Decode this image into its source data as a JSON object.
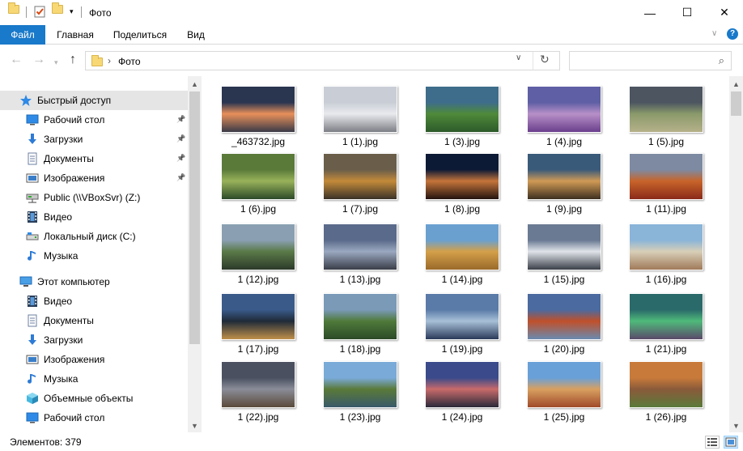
{
  "window": {
    "title": "Фото"
  },
  "titlebar": {
    "minimize": "—",
    "maximize": "☐",
    "close": "✕"
  },
  "ribbon": {
    "tabs": [
      "Файл",
      "Главная",
      "Поделиться",
      "Вид"
    ]
  },
  "address": {
    "crumb_sep": "›",
    "current": "Фото",
    "search_placeholder": ""
  },
  "nav": {
    "items": [
      {
        "label": "Быстрый доступ",
        "icon": "star-icon",
        "pinned": false,
        "selected": true
      },
      {
        "label": "Рабочий стол",
        "icon": "desktop-icon",
        "pinned": true
      },
      {
        "label": "Загрузки",
        "icon": "downloads-icon",
        "pinned": true
      },
      {
        "label": "Документы",
        "icon": "documents-icon",
        "pinned": true
      },
      {
        "label": "Изображения",
        "icon": "pictures-icon",
        "pinned": true
      },
      {
        "label": "Public (\\\\VBoxSvr) (Z:)",
        "icon": "network-drive-icon",
        "pinned": false
      },
      {
        "label": "Видео",
        "icon": "video-icon",
        "pinned": false
      },
      {
        "label": "Локальный диск (C:)",
        "icon": "local-disk-icon",
        "pinned": false
      },
      {
        "label": "Музыка",
        "icon": "music-icon",
        "pinned": false
      },
      {
        "label": "Этот компьютер",
        "icon": "this-pc-icon",
        "pinned": false
      },
      {
        "label": "Видео",
        "icon": "video-icon",
        "pinned": false
      },
      {
        "label": "Документы",
        "icon": "documents-icon",
        "pinned": false
      },
      {
        "label": "Загрузки",
        "icon": "downloads-icon",
        "pinned": false
      },
      {
        "label": "Изображения",
        "icon": "pictures-icon",
        "pinned": false
      },
      {
        "label": "Музыка",
        "icon": "music-icon",
        "pinned": false
      },
      {
        "label": "Объемные объекты",
        "icon": "3d-objects-icon",
        "pinned": false
      },
      {
        "label": "Рабочий стол",
        "icon": "desktop-icon",
        "pinned": false
      }
    ]
  },
  "files": [
    {
      "name": "_463732.jpg",
      "colors": [
        "#2a3550",
        "#e8905a",
        "#3a3a48"
      ]
    },
    {
      "name": "1 (1).jpg",
      "colors": [
        "#c9ced6",
        "#e9eaee",
        "#7d7f86"
      ]
    },
    {
      "name": "1 (3).jpg",
      "colors": [
        "#3d6d8a",
        "#4f8a3a",
        "#2c5a2a"
      ]
    },
    {
      "name": "1 (4).jpg",
      "colors": [
        "#5f5fa5",
        "#b890c8",
        "#6a3f8c"
      ]
    },
    {
      "name": "1 (5).jpg",
      "colors": [
        "#4c5560",
        "#8a9a6a",
        "#b6b18a"
      ]
    },
    {
      "name": "1 (6).jpg",
      "colors": [
        "#5a7a3a",
        "#98b25a",
        "#2c4a28"
      ]
    },
    {
      "name": "1 (7).jpg",
      "colors": [
        "#6a5e4a",
        "#c48a3a",
        "#3a3228"
      ]
    },
    {
      "name": "1 (8).jpg",
      "colors": [
        "#0d1a35",
        "#c5743a",
        "#241410"
      ]
    },
    {
      "name": "1 (9).jpg",
      "colors": [
        "#3a5a7a",
        "#d09a55",
        "#3d3020"
      ]
    },
    {
      "name": "1 (11).jpg",
      "colors": [
        "#7d8aa2",
        "#c8642a",
        "#8a2a1a"
      ]
    },
    {
      "name": "1 (12).jpg",
      "colors": [
        "#8aa0b2",
        "#5a7a48",
        "#2c3a2a"
      ]
    },
    {
      "name": "1 (13).jpg",
      "colors": [
        "#5a6a8a",
        "#9aa8c0",
        "#3a3e48"
      ]
    },
    {
      "name": "1 (14).jpg",
      "colors": [
        "#6aa0d0",
        "#d4a04a",
        "#9a6a2a"
      ]
    },
    {
      "name": "1 (15).jpg",
      "colors": [
        "#6a7a92",
        "#e0e4ea",
        "#3a3f48"
      ]
    },
    {
      "name": "1 (16).jpg",
      "colors": [
        "#8ab4d8",
        "#d8cfb8",
        "#a07a5a"
      ]
    },
    {
      "name": "1 (17).jpg",
      "colors": [
        "#3a5a8a",
        "#1f2a38",
        "#c0904a"
      ]
    },
    {
      "name": "1 (18).jpg",
      "colors": [
        "#7a9ab8",
        "#4f7a3a",
        "#2c4a28"
      ]
    },
    {
      "name": "1 (19).jpg",
      "colors": [
        "#5a7aa8",
        "#a8c0d8",
        "#2a3a5a"
      ]
    },
    {
      "name": "1 (20).jpg",
      "colors": [
        "#4a6aa0",
        "#c0502a",
        "#6a8ab0"
      ]
    },
    {
      "name": "1 (21).jpg",
      "colors": [
        "#2a6a6a",
        "#4fba7a",
        "#5a4a6a"
      ]
    },
    {
      "name": "1 (22).jpg",
      "colors": [
        "#4a5060",
        "#8a8c98",
        "#5a4a3a"
      ]
    },
    {
      "name": "1 (23).jpg",
      "colors": [
        "#7aaad8",
        "#5a7a3a",
        "#3a5a6a"
      ]
    },
    {
      "name": "1 (24).jpg",
      "colors": [
        "#3a4a8a",
        "#c86a6a",
        "#2a2a3a"
      ]
    },
    {
      "name": "1 (25).jpg",
      "colors": [
        "#6aa0d8",
        "#d8a060",
        "#a04a2a"
      ]
    },
    {
      "name": "1 (26).jpg",
      "colors": [
        "#c87a3a",
        "#8a5a3a",
        "#5a7a3a"
      ]
    }
  ],
  "status": {
    "item_count": "Элементов: 379"
  }
}
